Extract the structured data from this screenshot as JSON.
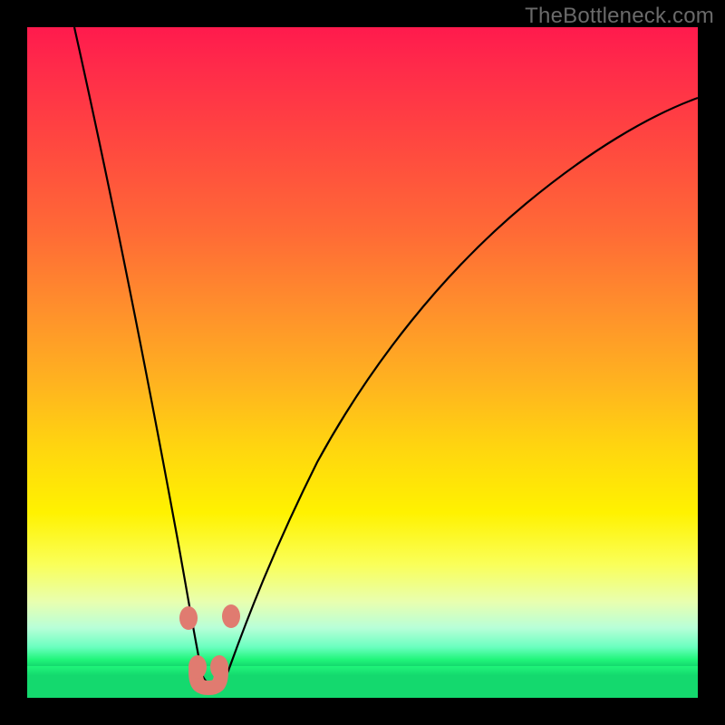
{
  "watermark": "TheBottleneck.com",
  "colors": {
    "frame_bg": "#000000",
    "curve_stroke": "#000000",
    "marker_fill": "#e07b70",
    "gradient_top": "#ff1a4d",
    "gradient_bottom": "#14d96e"
  },
  "chart_data": {
    "type": "line",
    "title": "",
    "xlabel": "",
    "ylabel": "",
    "xlim": [
      0,
      100
    ],
    "ylim": [
      0,
      100
    ],
    "grid": false,
    "note": "No axis ticks or labels are visible; values below are normalized 0–100 estimates read from pixel positions. The curve is a V-shaped bottleneck profile: steep descent from top-left to a minimum near x≈27, then a slower decelerating rise toward top-right.",
    "background_gradient": "vertical red→orange→yellow→green, green = optimal (low bottleneck)",
    "series": [
      {
        "name": "bottleneck-curve",
        "x": [
          7,
          11,
          15,
          19,
          22,
          24.5,
          27,
          29.5,
          32,
          35,
          40,
          46,
          53,
          61,
          70,
          80,
          90,
          100
        ],
        "values": [
          100,
          82,
          62,
          42,
          23,
          10,
          2.5,
          4,
          10,
          18,
          30,
          42,
          53,
          63,
          72,
          79,
          85,
          89
        ]
      }
    ],
    "markers": [
      {
        "name": "left-upper-dot",
        "x": 24.0,
        "y": 12
      },
      {
        "name": "left-lower-dot",
        "x": 25.5,
        "y": 4
      },
      {
        "name": "right-lower-dot",
        "x": 29.0,
        "y": 4
      },
      {
        "name": "right-upper-dot",
        "x": 30.5,
        "y": 12
      }
    ],
    "minimum_region": {
      "x_start": 25.5,
      "x_end": 29.0,
      "y": 2.5
    }
  }
}
